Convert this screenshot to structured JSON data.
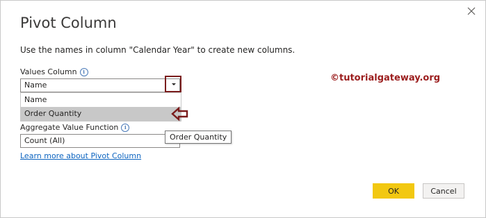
{
  "dialog": {
    "title": "Pivot Column",
    "description": "Use the names in column \"Calendar Year\" to create new columns.",
    "close_icon": "close-icon"
  },
  "values_column": {
    "label": "Values Column",
    "selected": "Name",
    "options": [
      "Name",
      "Order Quantity"
    ],
    "highlighted_option": "Order Quantity"
  },
  "aggregate": {
    "label": "Aggregate Value Function",
    "selected": "Count (All)"
  },
  "tooltip": "Order Quantity",
  "learn_more_link": "Learn more about Pivot Column",
  "watermark": "©tutorialgateway.org",
  "buttons": {
    "ok": "OK",
    "cancel": "Cancel"
  },
  "colors": {
    "ok_button": "#f2c811",
    "annotation": "#7a1c1c",
    "link": "#0c64c0",
    "selected_option_bg": "#c8c8c8"
  }
}
